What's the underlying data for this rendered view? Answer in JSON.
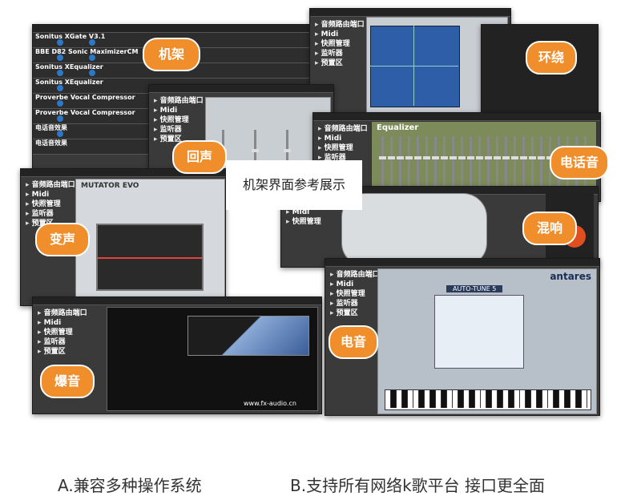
{
  "labels": {
    "rack": "机架",
    "surround": "环绕",
    "echo": "回声",
    "phone": "电话音",
    "center": "机架界面参考展示",
    "voice_change": "变声",
    "reverb": "混响",
    "autotune": "电音",
    "burst": "爆音"
  },
  "sidebar": [
    "音频路由端口",
    "Midi",
    "快照管理",
    "监听器",
    "预置区"
  ],
  "rack_rows": [
    "Sonitus XGate V3.1",
    "BBE D82 Sonic MaximizerCM",
    "Sonitus XEqualizer",
    "Proverbe Vocal Compressor",
    "电话音效果"
  ],
  "plugins": {
    "mutator": "MUTATOR EVO",
    "equalizer": "Equalizer",
    "antares": "antares",
    "autotune_title": "AUTO-TUNE 5",
    "burst_footer": "www.fx-audio.cn"
  },
  "captions": {
    "a": "A.兼容多种操作系统",
    "b": "B.支持所有网络k歌平台 接口更全面"
  },
  "colors": {
    "accent": "#ef8e2a",
    "panel_dark": "#3a3a3a",
    "screen_blue": "#2f5ea8"
  }
}
